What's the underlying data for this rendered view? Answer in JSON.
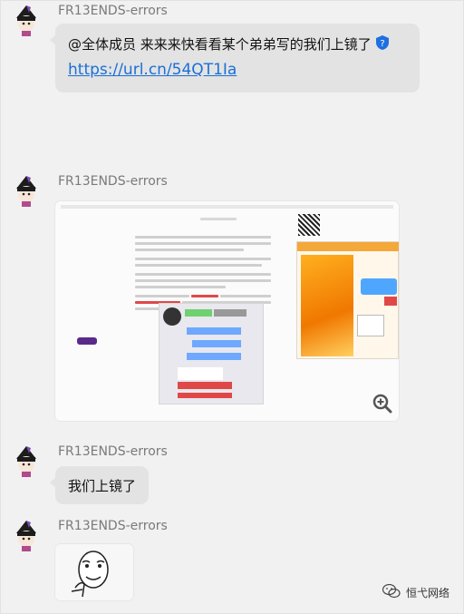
{
  "messages": [
    {
      "sender": "FR13ENDS-errors",
      "text": "@全体成员 来来来快看看某个弟弟写的我们上镜了",
      "link": "https://url.cn/54QT1Ia"
    },
    {
      "sender": "FR13ENDS-errors",
      "image_caption": "shared-screenshot"
    },
    {
      "sender": "FR13ENDS-errors",
      "text": "我们上镜了"
    },
    {
      "sender": "FR13ENDS-errors",
      "image_caption": "meme-face"
    }
  ],
  "footer": {
    "brand": "恒弋网络"
  },
  "colors": {
    "bubble": "#e3e3e3",
    "link": "#1a6fd8",
    "name": "#7a7a7a",
    "verified": "#1e6fe0"
  }
}
